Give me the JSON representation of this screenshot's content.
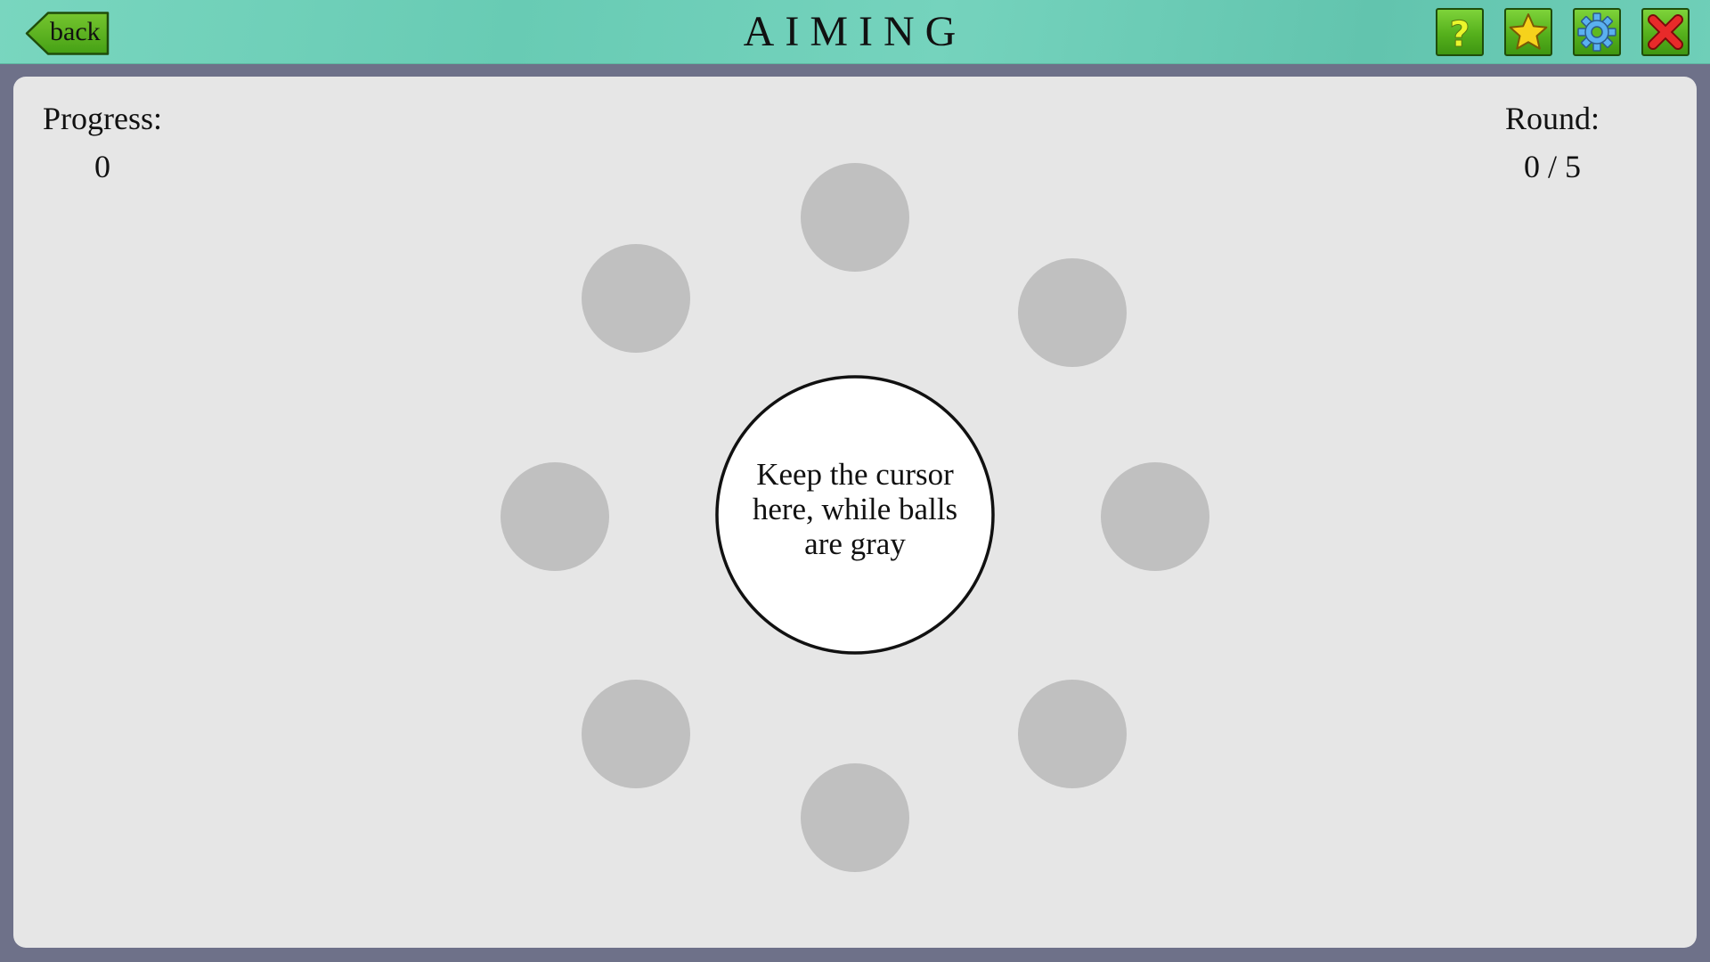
{
  "header": {
    "title": "AIMING",
    "back_label": "back",
    "tools": [
      {
        "name": "help",
        "icon": "question-icon",
        "color": "#e9f52a"
      },
      {
        "name": "favorite",
        "icon": "star-icon",
        "color": "#f5d21a"
      },
      {
        "name": "settings",
        "icon": "gear-icon",
        "color": "#5ab0f0"
      },
      {
        "name": "close",
        "icon": "close-icon",
        "color": "#e82a2a"
      }
    ]
  },
  "stats": {
    "progress_label": "Progress:",
    "progress_value": "0",
    "round_label": "Round:",
    "round_value": "0 / 5"
  },
  "game": {
    "center_text": "Keep the cursor here, while balls are gray",
    "ball_color": "#c0c0c0",
    "ball_count": 8
  }
}
